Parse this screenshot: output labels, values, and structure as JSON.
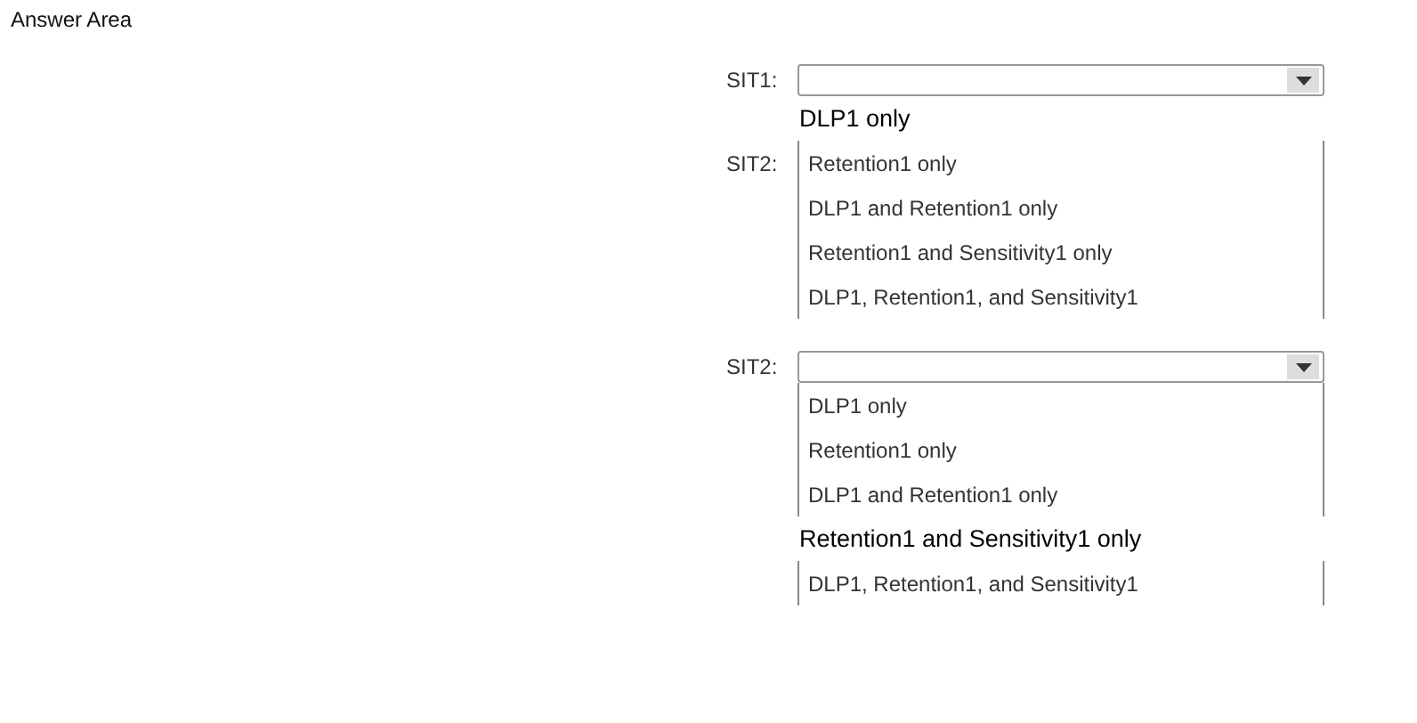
{
  "title": "Answer Area",
  "dropdowns": [
    {
      "label": "SIT1:",
      "options": [
        {
          "text": "DLP1 only",
          "kind": "loose"
        },
        {
          "text": "Retention1 only",
          "kind": "boxed",
          "side_label": "SIT2:"
        },
        {
          "text": "DLP1 and Retention1 only",
          "kind": "boxed"
        },
        {
          "text": "Retention1 and Sensitivity1 only",
          "kind": "boxed"
        },
        {
          "text": "DLP1, Retention1, and Sensitivity1",
          "kind": "boxed"
        }
      ]
    },
    {
      "label": "SIT2:",
      "options": [
        {
          "text": "DLP1 only",
          "kind": "boxed"
        },
        {
          "text": "Retention1 only",
          "kind": "boxed"
        },
        {
          "text": "DLP1 and Retention1 only",
          "kind": "boxed"
        },
        {
          "text": "Retention1 and Sensitivity1 only",
          "kind": "loose"
        },
        {
          "text": "DLP1, Retention1, and Sensitivity1",
          "kind": "boxed"
        }
      ]
    }
  ]
}
